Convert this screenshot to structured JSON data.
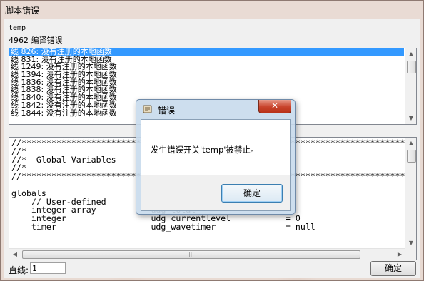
{
  "window": {
    "title": "脚本错误"
  },
  "script_name": "temp",
  "error_summary": "4962 编译错误",
  "errors": [
    "线 826: 没有注册的本地函数",
    "线 831: 没有注册的本地函数",
    "线 1249: 没有注册的本地函数",
    "线 1394: 没有注册的本地函数",
    "线 1836: 没有注册的本地函数",
    "线 1838: 没有注册的本地函数",
    "线 1840: 没有注册的本地函数",
    "线 1842: 没有注册的本地函数",
    "线 1844: 没有注册的本地函数"
  ],
  "code_lines": [
    "//*****************************************************************************",
    "//*",
    "//*  Global Variables",
    "//*",
    "//*****************************************************************************",
    "",
    "globals",
    "    // User-defined",
    "    integer array           udg_total",
    "    integer                 udg_currentlevel           = 0",
    "    timer                   udg_wavetimer              = null"
  ],
  "line_field": {
    "label": "直线:",
    "value": "1"
  },
  "ok_button": "确定",
  "dialog": {
    "title": "错误",
    "close": "✕",
    "message": "发生错误开关'temp'被禁止。",
    "ok": "确定"
  }
}
